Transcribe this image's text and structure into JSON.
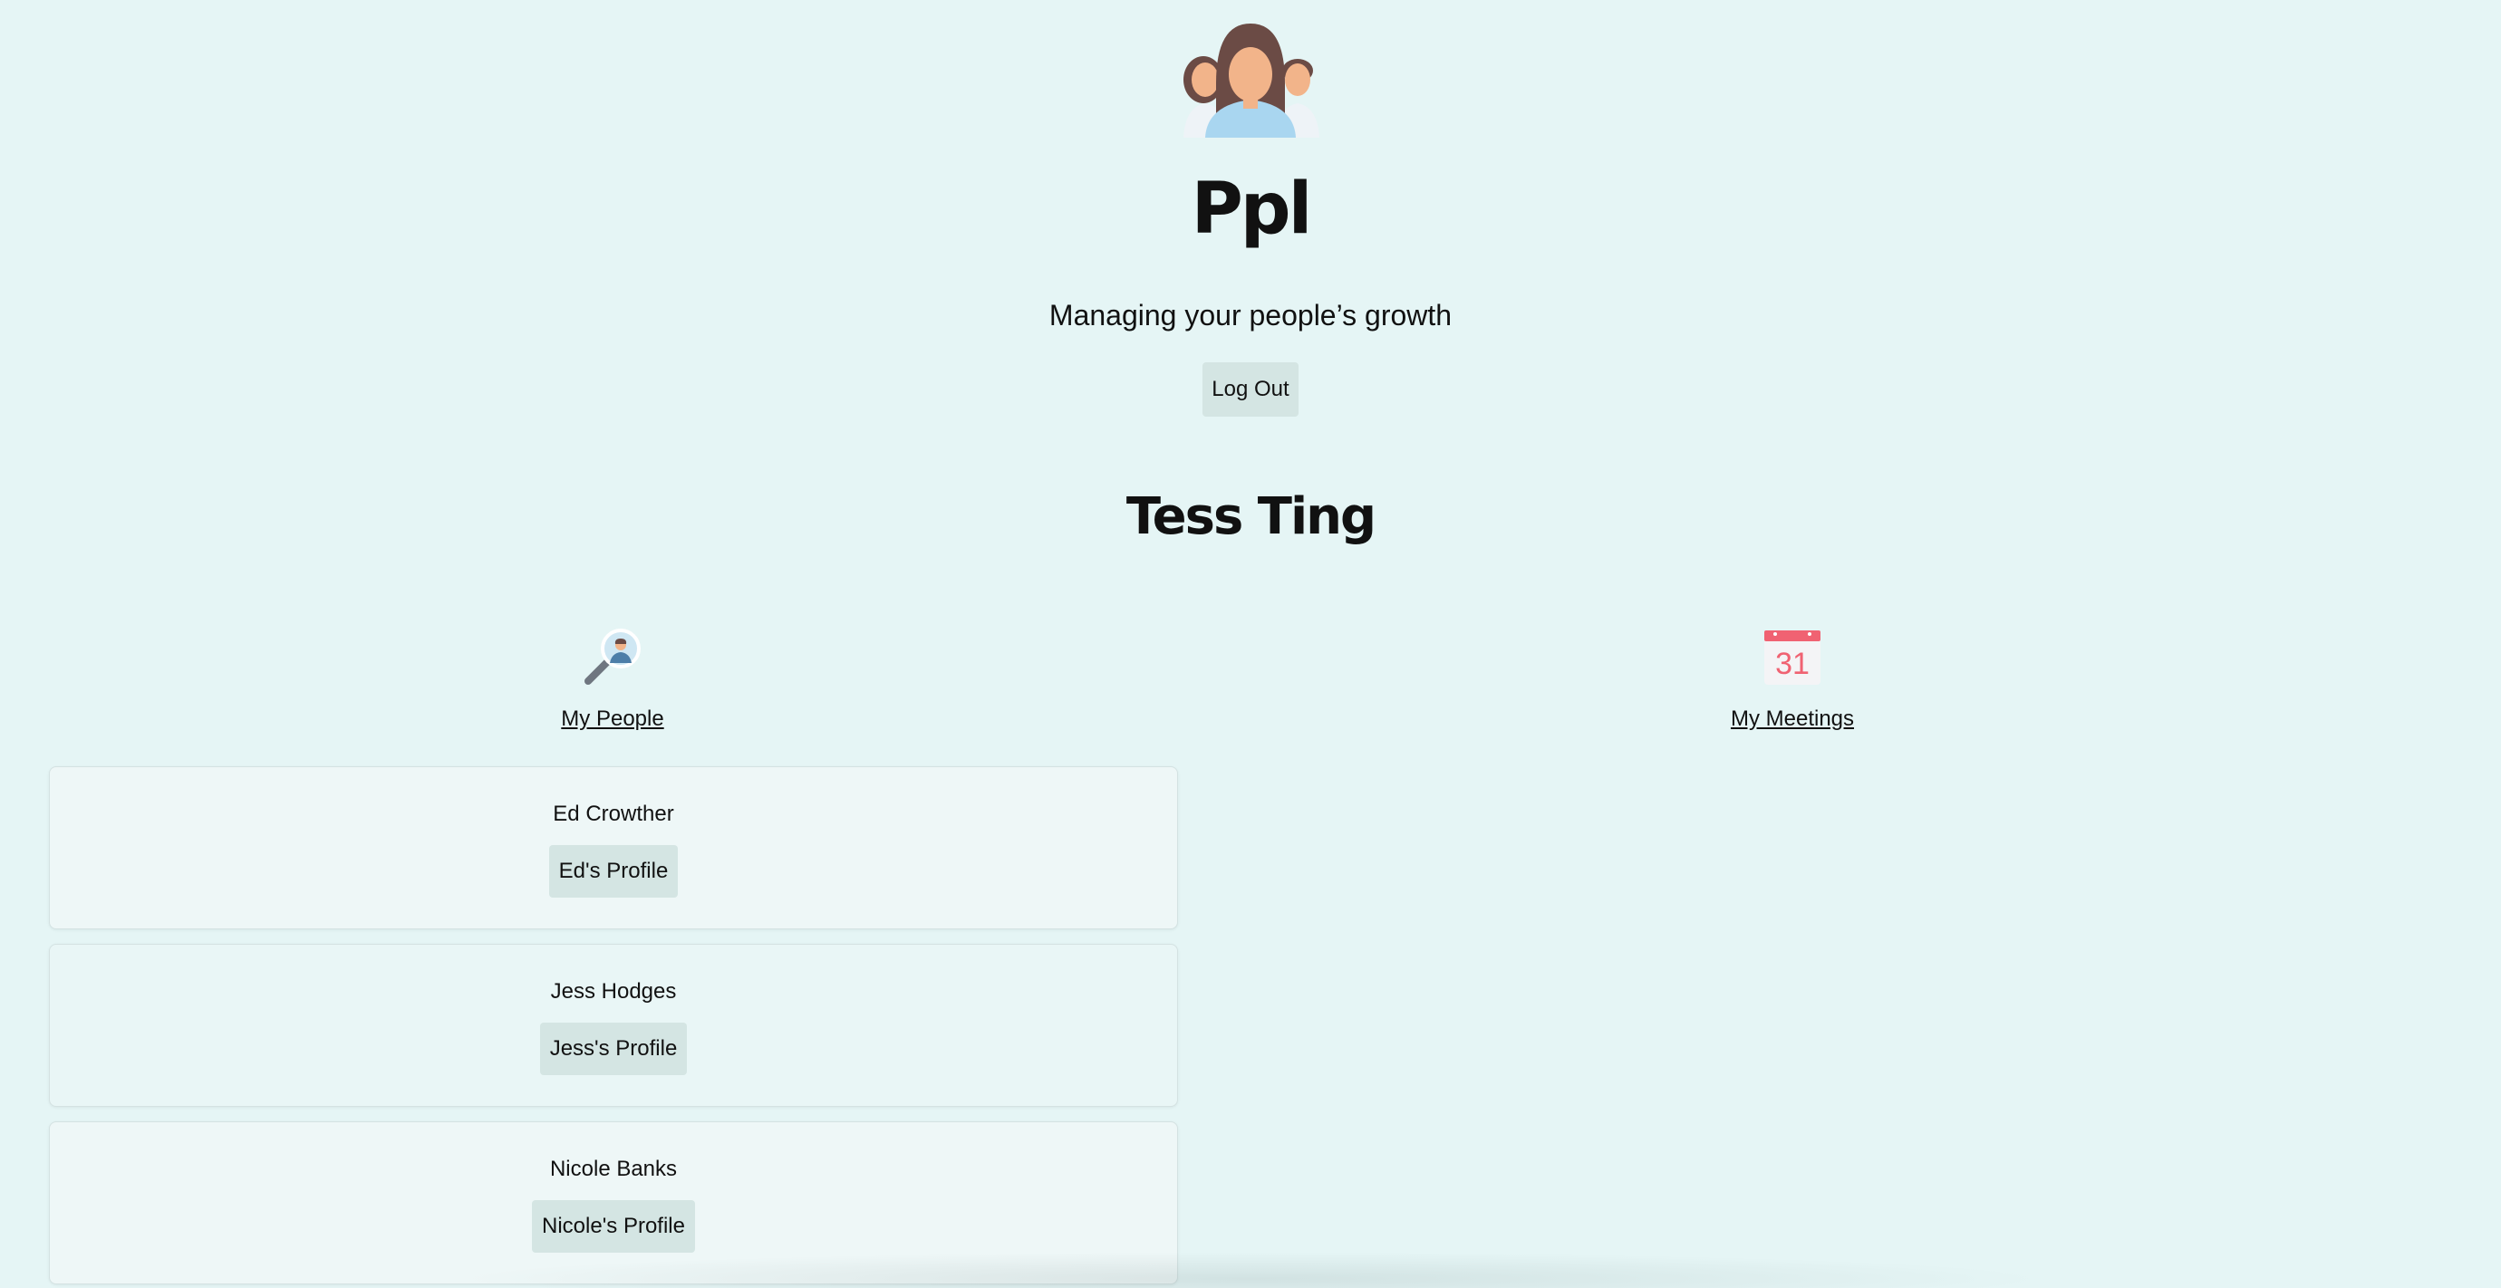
{
  "header": {
    "logo_icon": "people-group-icon",
    "title": "Ppl",
    "subtitle": "Managing your people’s growth",
    "logout_label": "Log Out"
  },
  "user": {
    "name": "Tess Ting"
  },
  "sections": {
    "people": {
      "icon": "magnifier-person-icon",
      "link_label": "My People"
    },
    "meetings": {
      "icon": "calendar-icon",
      "calendar_day": "31",
      "link_label": "My Meetings"
    }
  },
  "people": [
    {
      "name": "Ed Crowther",
      "profile_label": "Ed's Profile"
    },
    {
      "name": "Jess Hodges",
      "profile_label": "Jess's Profile"
    },
    {
      "name": "Nicole Banks",
      "profile_label": "Nicole's Profile"
    }
  ],
  "colors": {
    "background": "#e5f5f5",
    "card": "#eef7f7",
    "button": "#d4e5e3",
    "calendar_red": "#f06272"
  }
}
